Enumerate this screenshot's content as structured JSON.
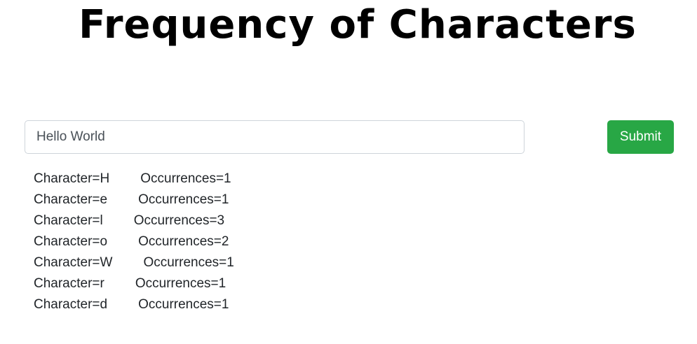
{
  "header": {
    "title": "Frequency of Characters"
  },
  "form": {
    "input_value": "Hello World",
    "submit_label": "Submit"
  },
  "results": [
    {
      "character": "Character=H",
      "occurrences": "Occurrences=1"
    },
    {
      "character": "Character=e",
      "occurrences": "Occurrences=1"
    },
    {
      "character": "Character=l",
      "occurrences": "Occurrences=3"
    },
    {
      "character": "Character=o",
      "occurrences": "Occurrences=2"
    },
    {
      "character": "Character=W",
      "occurrences": "Occurrences=1"
    },
    {
      "character": "Character=r",
      "occurrences": "Occurrences=1"
    },
    {
      "character": "Character=d",
      "occurrences": "Occurrences=1"
    }
  ],
  "colors": {
    "submit_background": "#28a745",
    "input_border": "#ced4da"
  }
}
